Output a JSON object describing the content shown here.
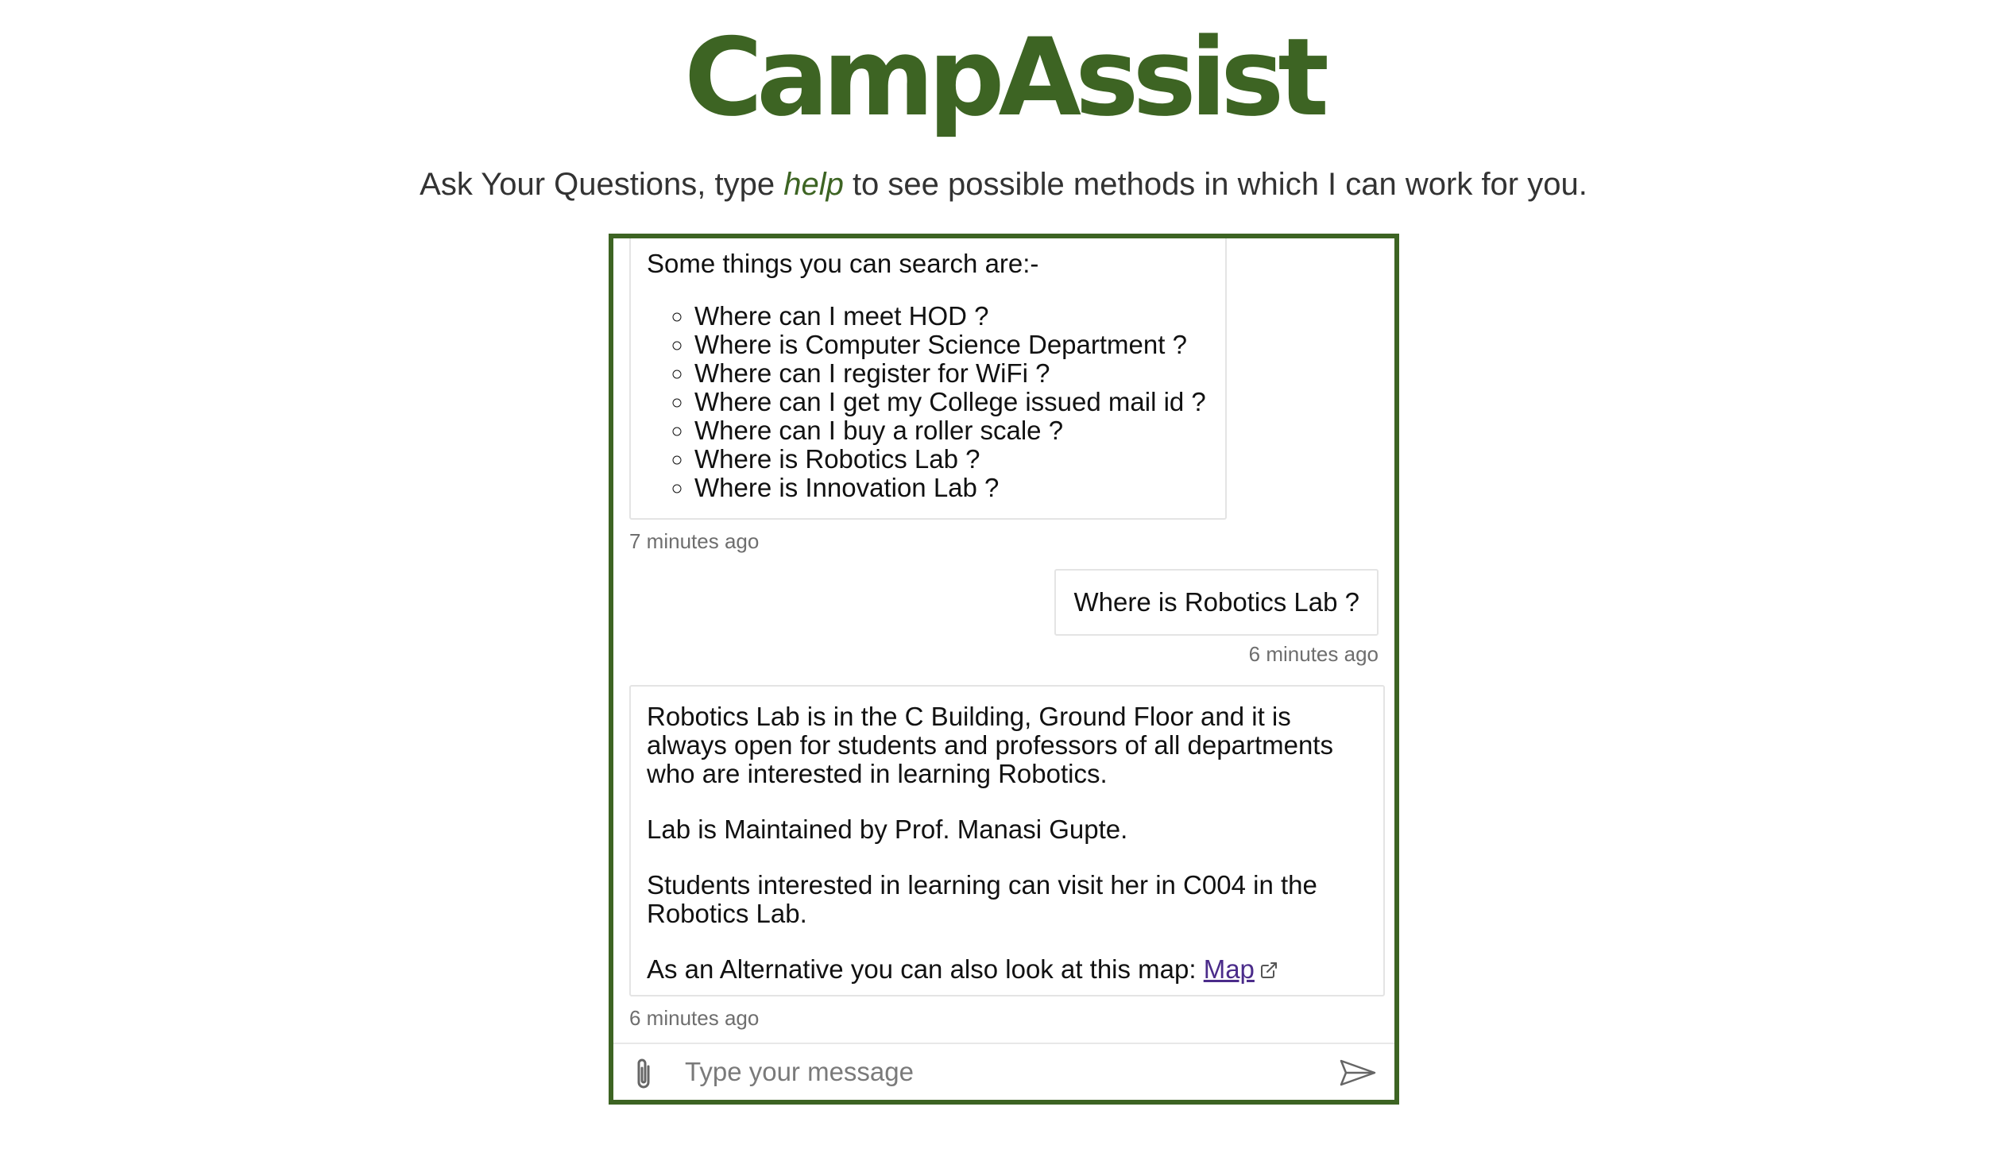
{
  "header": {
    "title": "CampAssist",
    "subtitle_before": "Ask Your Questions, type ",
    "subtitle_keyword": "help",
    "subtitle_after": " to see possible methods in which I can work for you."
  },
  "chat": {
    "messages": [
      {
        "sender": "bot",
        "intro": "Some things you can search are:-",
        "items": [
          "Where can I meet HOD ?",
          "Where is Computer Science Department ?",
          "Where can I register for WiFi ?",
          "Where can I get my College issued mail id ?",
          "Where can I buy a roller scale ?",
          "Where is Robotics Lab ?",
          "Where is Innovation Lab ?"
        ],
        "timestamp": "7 minutes ago"
      },
      {
        "sender": "user",
        "text": "Where is Robotics Lab ?",
        "timestamp": "6 minutes ago"
      },
      {
        "sender": "bot",
        "paragraphs": [
          "Robotics Lab is in the C Building, Ground Floor and it is always open for students and professors of all departments who are interested in learning Robotics.",
          "Lab is Maintained by Prof. Manasi Gupte.",
          "Students interested in learning can visit her in C004 in the Robotics Lab."
        ],
        "link_prefix": "As an Alternative you can also look at this map: ",
        "link_label": "Map",
        "timestamp": "6 minutes ago"
      }
    ]
  },
  "composer": {
    "placeholder": "Type your message",
    "value": "",
    "attach_icon": "paperclip-icon",
    "send_icon": "send-icon"
  },
  "colors": {
    "brand": "#3d6423",
    "link": "#4b2c8a"
  }
}
